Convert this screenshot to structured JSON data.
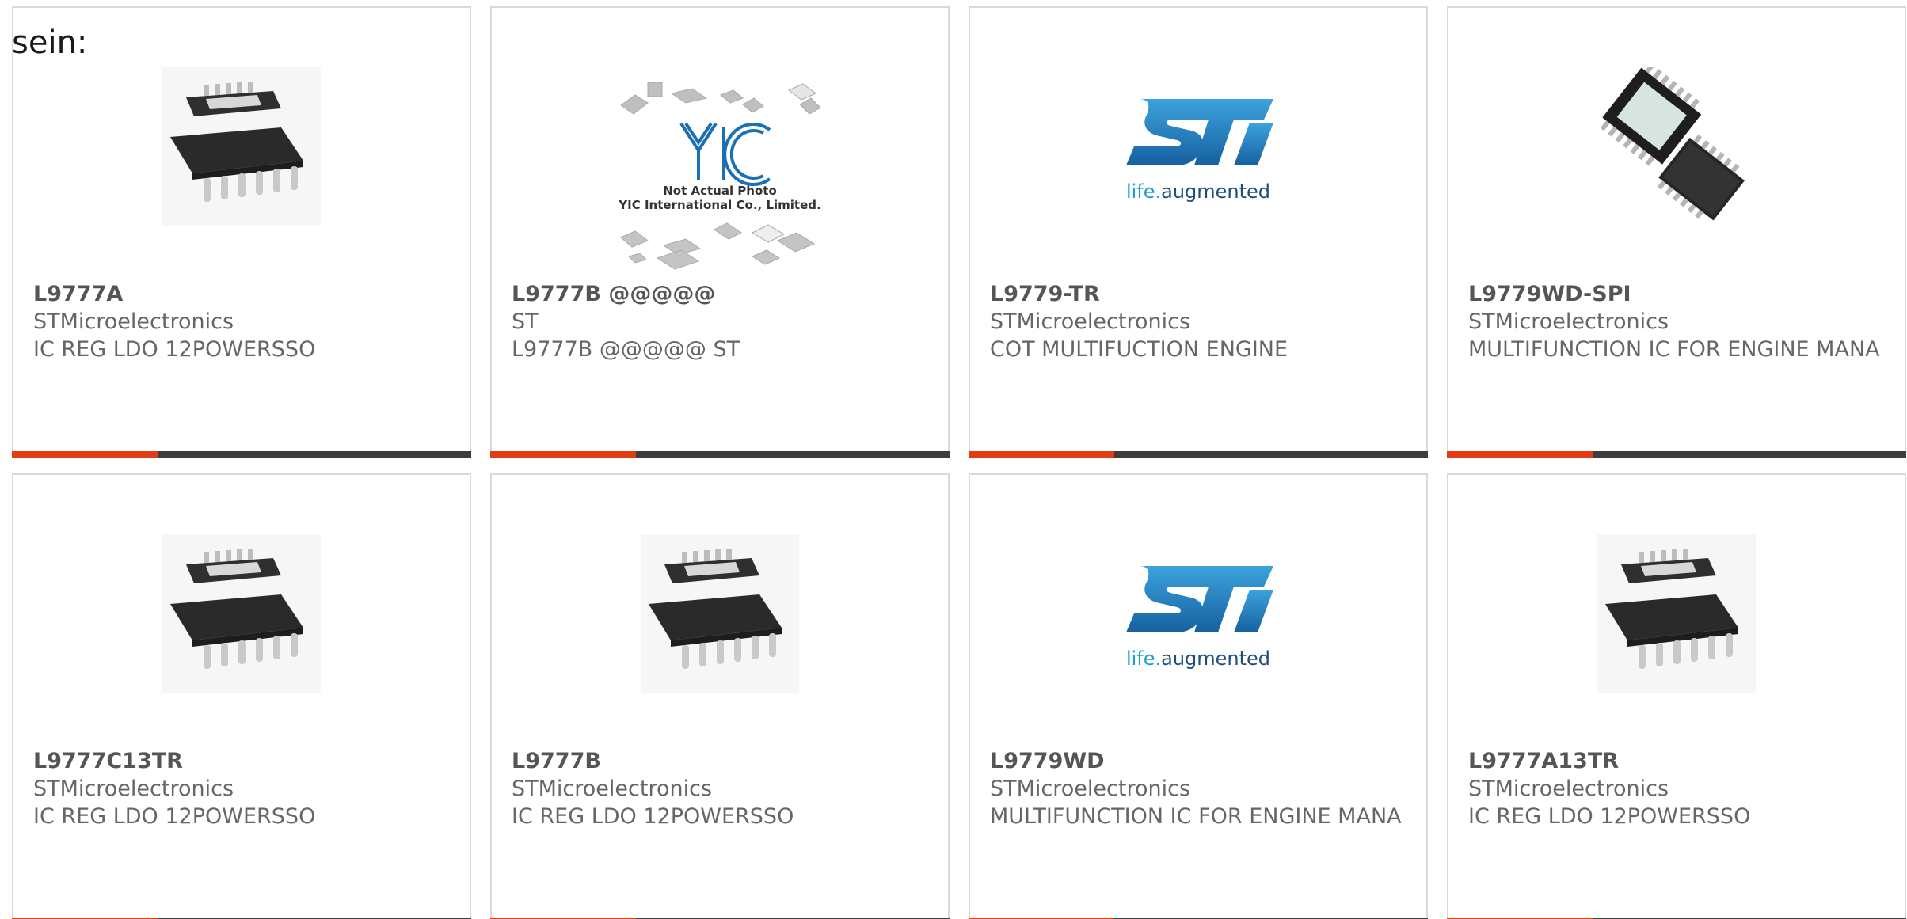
{
  "intro": {
    "text": "sein:"
  },
  "colors": {
    "accent": "#e23c12",
    "bar": "#3d3d3d",
    "st_blue": "#1d6da3",
    "st_text": "#1c9bd7"
  },
  "products": [
    {
      "part_number": "L9777A",
      "manufacturer": "STMicroelectronics",
      "description": "IC REG LDO 12POWERSSO",
      "image": "chip-package-icon"
    },
    {
      "part_number": "L9777B @@@@@",
      "manufacturer": "ST",
      "description": "L9777B @@@@@ ST",
      "image": "not-actual-photo-icon",
      "image_caption_line1": "Not Actual Photo",
      "image_caption_line2": "YIC International Co., Limited.",
      "image_logo": "YIC"
    },
    {
      "part_number": "L9779-TR",
      "manufacturer": "STMicroelectronics",
      "description": "COT MULTIFUCTION ENGINE",
      "image": "st-logo-icon",
      "image_tagline_a": "life.",
      "image_tagline_b": "augmented"
    },
    {
      "part_number": "L9779WD-SPI",
      "manufacturer": "STMicroelectronics",
      "description": "MULTIFUNCTION IC FOR ENGINE MANA",
      "image": "power-pad-package-icon"
    },
    {
      "part_number": "L9777C13TR",
      "manufacturer": "STMicroelectronics",
      "description": "IC REG LDO 12POWERSSO",
      "image": "chip-package-icon"
    },
    {
      "part_number": "L9777B",
      "manufacturer": "STMicroelectronics",
      "description": "IC REG LDO 12POWERSSO",
      "image": "chip-package-icon"
    },
    {
      "part_number": "L9779WD",
      "manufacturer": "STMicroelectronics",
      "description": "MULTIFUNCTION IC FOR ENGINE MANA",
      "image": "st-logo-icon",
      "image_tagline_a": "life.",
      "image_tagline_b": "augmented"
    },
    {
      "part_number": "L9777A13TR",
      "manufacturer": "STMicroelectronics",
      "description": "IC REG LDO 12POWERSSO",
      "image": "chip-package-icon"
    }
  ]
}
